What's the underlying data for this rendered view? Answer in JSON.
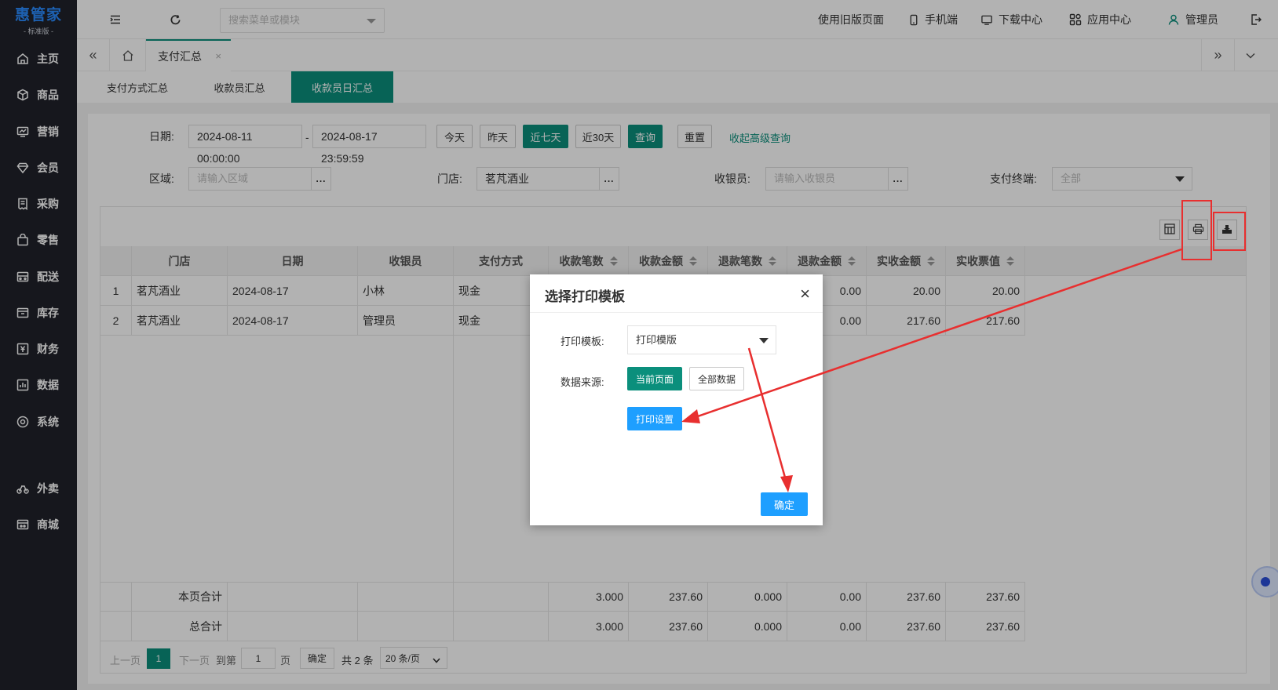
{
  "brand": {
    "logo": "惠管家",
    "edition": "- 标准版 -"
  },
  "sidebar": {
    "items": [
      {
        "label": "主页",
        "icon": "home-icon"
      },
      {
        "label": "商品",
        "icon": "box-icon"
      },
      {
        "label": "营销",
        "icon": "chart-icon"
      },
      {
        "label": "会员",
        "icon": "diamond-icon"
      },
      {
        "label": "采购",
        "icon": "receipt-icon"
      },
      {
        "label": "零售",
        "icon": "bag-icon"
      },
      {
        "label": "配送",
        "icon": "truck-icon"
      },
      {
        "label": "库存",
        "icon": "inventory-icon"
      },
      {
        "label": "财务",
        "icon": "yen-icon"
      },
      {
        "label": "数据",
        "icon": "bar-chart-icon"
      },
      {
        "label": "系统",
        "icon": "target-icon"
      },
      {
        "label": "外卖",
        "icon": "bike-icon"
      },
      {
        "label": "商城",
        "icon": "store-icon"
      }
    ]
  },
  "header": {
    "search_placeholder": "搜索菜单或模块",
    "old_page": "使用旧版页面",
    "mobile": "手机端",
    "download": "下载中心",
    "apps": "应用中心",
    "user": "管理员"
  },
  "tabs": {
    "active": "支付汇总"
  },
  "subtabs": [
    "支付方式汇总",
    "收款员汇总",
    "收款员日汇总"
  ],
  "filters": {
    "date_label": "日期:",
    "date_start": "2024-08-11 00:00:00",
    "date_sep": "-",
    "date_end": "2024-08-17 23:59:59",
    "quick": [
      "今天",
      "昨天",
      "近七天",
      "近30天"
    ],
    "query": "查询",
    "reset": "重置",
    "collapse": "收起高级查询",
    "area_label": "区域:",
    "area_placeholder": "请输入区域",
    "store_label": "门店:",
    "store_value": "茗芃酒业",
    "cashier_label": "收银员:",
    "cashier_placeholder": "请输入收银员",
    "terminal_label": "支付终端:",
    "terminal_value": "全部",
    "more": "..."
  },
  "table": {
    "columns": [
      "门店",
      "日期",
      "收银员",
      "支付方式",
      "收款笔数",
      "收款金额",
      "退款笔数",
      "退款金额",
      "实收金额",
      "实收票值"
    ],
    "rows": [
      {
        "no": "1",
        "store": "茗芃酒业",
        "date": "2024-08-17",
        "cashier": "小林",
        "method": "现金",
        "refund_amt": "0.00",
        "net": "20.00",
        "ticket": "20.00"
      },
      {
        "no": "2",
        "store": "茗芃酒业",
        "date": "2024-08-17",
        "cashier": "管理员",
        "method": "现金",
        "refund_amt": "0.00",
        "net": "217.60",
        "ticket": "217.60"
      }
    ],
    "page_total": {
      "label": "本页合计",
      "count": "3.000",
      "amount": "237.60",
      "refund_count": "0.000",
      "refund_amt": "0.00",
      "net": "237.60",
      "ticket": "237.60"
    },
    "grand_total": {
      "label": "总合计",
      "count": "3.000",
      "amount": "237.60",
      "refund_count": "0.000",
      "refund_amt": "0.00",
      "net": "237.60",
      "ticket": "237.60"
    }
  },
  "pagination": {
    "prev": "上一页",
    "current": "1",
    "next": "下一页",
    "goto": "到第",
    "page_input": "1",
    "page_unit": "页",
    "confirm": "确定",
    "total": "共 2 条",
    "per_page": "20 条/页"
  },
  "modal": {
    "title": "选择打印模板",
    "template_label": "打印模板:",
    "template_value": "打印模版",
    "source_label": "数据来源:",
    "source_current": "当前页面",
    "source_all": "全部数据",
    "print_settings": "打印设置",
    "ok": "确定"
  },
  "colors": {
    "accent": "#0b8f7c",
    "blue": "#1e9fff",
    "annotation": "#e82f2f",
    "sidebar": "#20222a"
  }
}
